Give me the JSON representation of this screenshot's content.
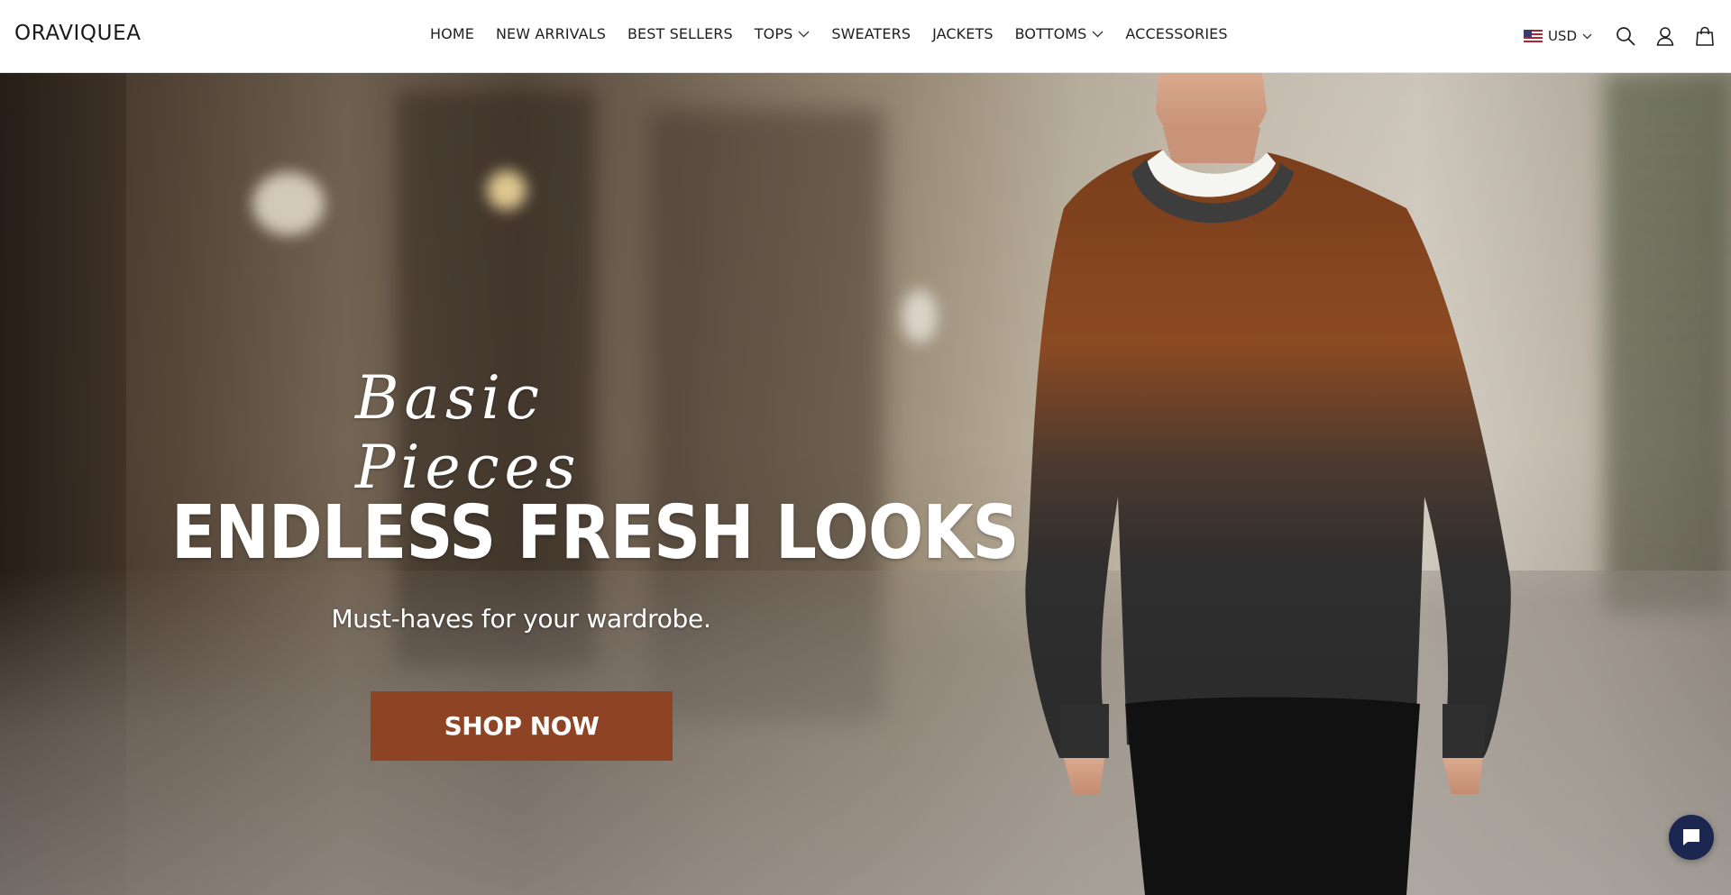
{
  "brand": {
    "name": "ORAVIQUEA"
  },
  "nav": {
    "items": [
      {
        "label": "HOME",
        "has_dropdown": false
      },
      {
        "label": "NEW ARRIVALS",
        "has_dropdown": false
      },
      {
        "label": "BEST SELLERS",
        "has_dropdown": false
      },
      {
        "label": "TOPS",
        "has_dropdown": true
      },
      {
        "label": "SWEATERS",
        "has_dropdown": false
      },
      {
        "label": "JACKETS",
        "has_dropdown": false
      },
      {
        "label": "BOTTOMS",
        "has_dropdown": true
      },
      {
        "label": "ACCESSORIES",
        "has_dropdown": false
      }
    ]
  },
  "header_actions": {
    "currency": {
      "label": "USD",
      "flag": "us-flag-icon"
    },
    "icons": [
      "search-icon",
      "account-icon",
      "cart-bag-icon"
    ]
  },
  "hero": {
    "script_title": "Basic Pieces",
    "title": "ENDLESS FRESH LOOKS",
    "subtitle": "Must-haves for your wardrobe.",
    "cta_label": "SHOP NOW",
    "cta_color": "#8e4324"
  },
  "chat": {
    "icon": "chat-bubble-icon",
    "color": "#1b2750"
  }
}
